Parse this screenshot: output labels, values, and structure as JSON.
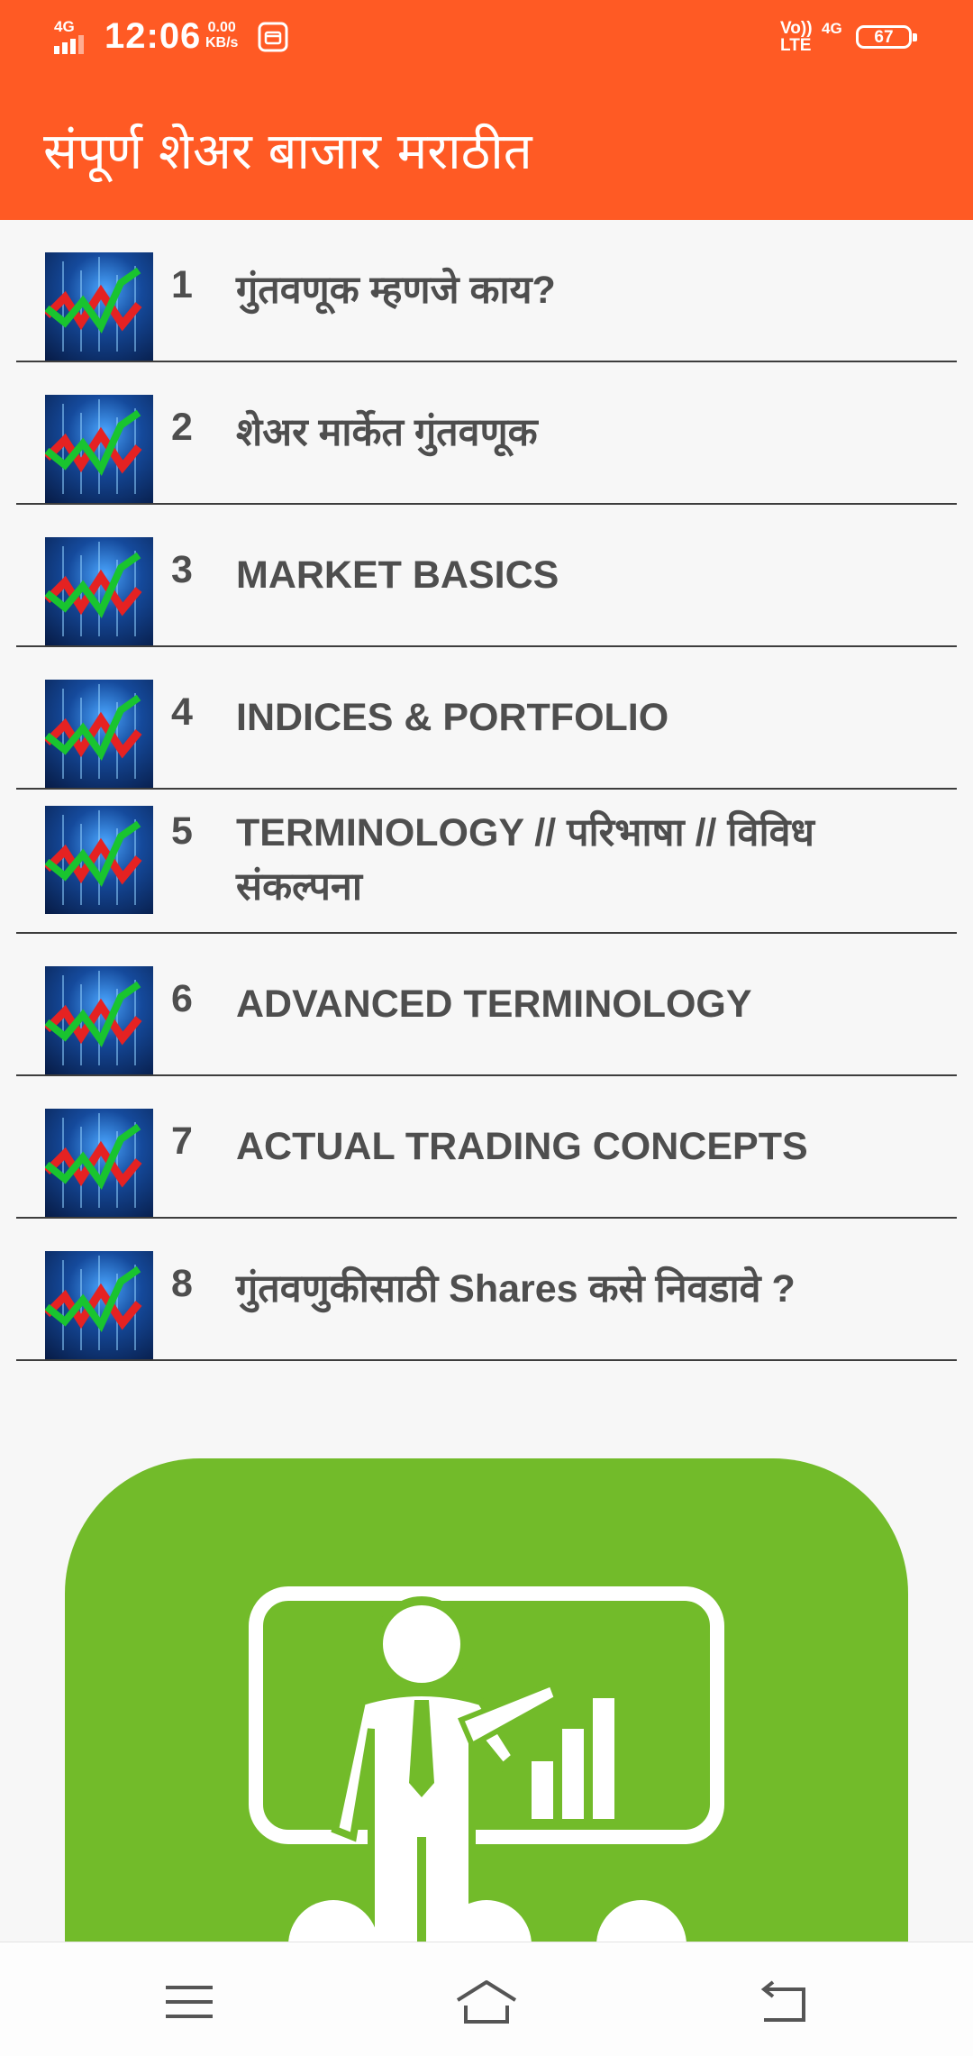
{
  "status_bar": {
    "network": "4G",
    "time": "12:06",
    "speed_value": "0.00",
    "speed_unit": "KB/s",
    "volte_top": "Vo))",
    "volte_bottom": "LTE",
    "network2": "4G",
    "battery": "67"
  },
  "app_bar": {
    "title": "संपूर्ण शेअर बाजार मराठीत",
    "color": "#ff5a24"
  },
  "topics": [
    {
      "number": "1",
      "title": "गुंतवणूक म्हणजे काय?"
    },
    {
      "number": "2",
      "title": "शेअर मार्केत गुंतवणूक"
    },
    {
      "number": "3",
      "title": "MARKET BASICS"
    },
    {
      "number": "4",
      "title": "INDICES & PORTFOLIO"
    },
    {
      "number": "5",
      "title": "TERMINOLOGY // परिभाषा // विविध संकल्पना"
    },
    {
      "number": "6",
      "title": "ADVANCED TERMINOLOGY"
    },
    {
      "number": "7",
      "title": "ACTUAL TRADING CONCEPTS"
    },
    {
      "number": "8",
      "title": "गुंतवणुकीसाठी Shares कसे निवडावे ?"
    }
  ],
  "promo": {
    "icon": "presenter-with-chart-icon",
    "color": "#72bb2a"
  },
  "nav_bar": {
    "icons": [
      "menu-icon",
      "home-icon",
      "back-icon"
    ]
  }
}
